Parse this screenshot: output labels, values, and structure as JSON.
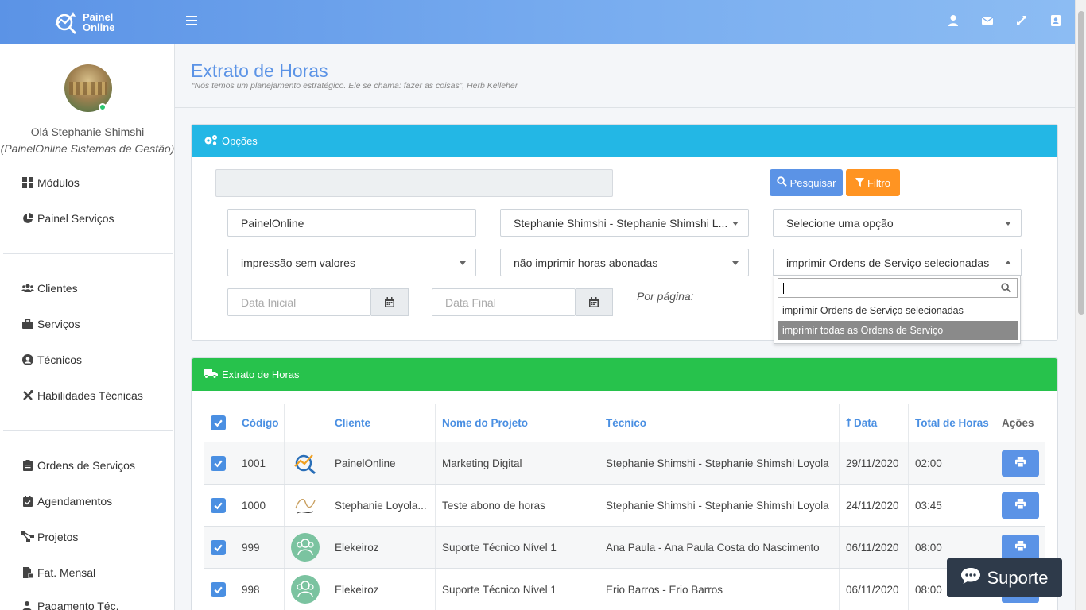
{
  "header": {
    "logo_line1": "Painel",
    "logo_line2": "Online"
  },
  "sidebar": {
    "greeting": "Olá Stephanie Shimshi",
    "company": "(PainelOnline Sistemas de Gestão)",
    "items": [
      {
        "label": "Módulos",
        "icon": "grid-icon"
      },
      {
        "label": "Painel Serviços",
        "icon": "pie-chart-icon"
      },
      {
        "label": "Clientes",
        "icon": "users-icon"
      },
      {
        "label": "Serviços",
        "icon": "briefcase-icon"
      },
      {
        "label": "Técnicos",
        "icon": "user-circle-icon"
      },
      {
        "label": "Habilidades Técnicas",
        "icon": "tools-icon"
      },
      {
        "label": "Ordens de Serviços",
        "icon": "clipboard-icon"
      },
      {
        "label": "Agendamentos",
        "icon": "calendar-check-icon"
      },
      {
        "label": "Projetos",
        "icon": "project-diagram-icon"
      },
      {
        "label": "Fat. Mensal",
        "icon": "file-invoice-icon"
      },
      {
        "label": "Pagamento Téc.",
        "icon": "user-dollar-icon"
      }
    ]
  },
  "page": {
    "title": "Extrato de Horas",
    "quote": "“Nós temos um planejamento estratégico. Ele se chama: fazer as coisas”, Herb Kelleher"
  },
  "options": {
    "title": "Opções",
    "search_label": "Pesquisar",
    "filter_label": "Filtro",
    "client_value": "PainelOnline",
    "tecnico_value": "Stephanie Shimshi - Stephanie Shimshi L...",
    "third_value": "Selecione uma opção",
    "print_values_value": "impressão sem valores",
    "abonadas_value": "não imprimir horas abonadas",
    "os_value": "imprimir Ordens de Serviço selecionadas",
    "date_start_placeholder": "Data Inicial",
    "date_end_placeholder": "Data Final",
    "per_page_label": "Por página:",
    "dropdown_options": [
      "imprimir Ordens de Serviço selecionadas",
      "imprimir todas as Ordens de Serviço"
    ]
  },
  "extrato": {
    "title": "Extrato de Horas",
    "columns": [
      "Código",
      "Cliente",
      "Nome do Projeto",
      "Técnico",
      "Data",
      "Total de Horas",
      "Ações"
    ],
    "rows": [
      {
        "codigo": "1001",
        "cliente": "PainelOnline",
        "projeto": "Marketing Digital",
        "tecnico": "Stephanie Shimshi - Stephanie Shimshi Loyola",
        "data": "29/11/2020",
        "horas": "02:00",
        "logo": "painelonline-logo"
      },
      {
        "codigo": "1000",
        "cliente": "Stephanie Loyola...",
        "projeto": "Teste abono de horas",
        "tecnico": "Stephanie Shimshi - Stephanie Shimshi Loyola",
        "data": "24/11/2020",
        "horas": "03:45",
        "logo": "signature-logo"
      },
      {
        "codigo": "999",
        "cliente": "Elekeiroz",
        "projeto": "Suporte Técnico Nível 1",
        "tecnico": "Ana Paula - Ana Paula Costa do Nascimento",
        "data": "06/11/2020",
        "horas": "08:00",
        "logo": "people-placeholder"
      },
      {
        "codigo": "998",
        "cliente": "Elekeiroz",
        "projeto": "Suporte Técnico Nível 1",
        "tecnico": "Erio Barros - Erio Barros",
        "data": "06/11/2020",
        "horas": "08:00",
        "logo": "people-placeholder"
      }
    ]
  },
  "support": {
    "label": "Suporte"
  },
  "colors": {
    "brand_blue": "#5b93e6",
    "options_header": "#23b7e5",
    "extrato_header": "#27c24c",
    "filter_orange": "#ff9422",
    "support_dark": "#2e3a4a"
  }
}
